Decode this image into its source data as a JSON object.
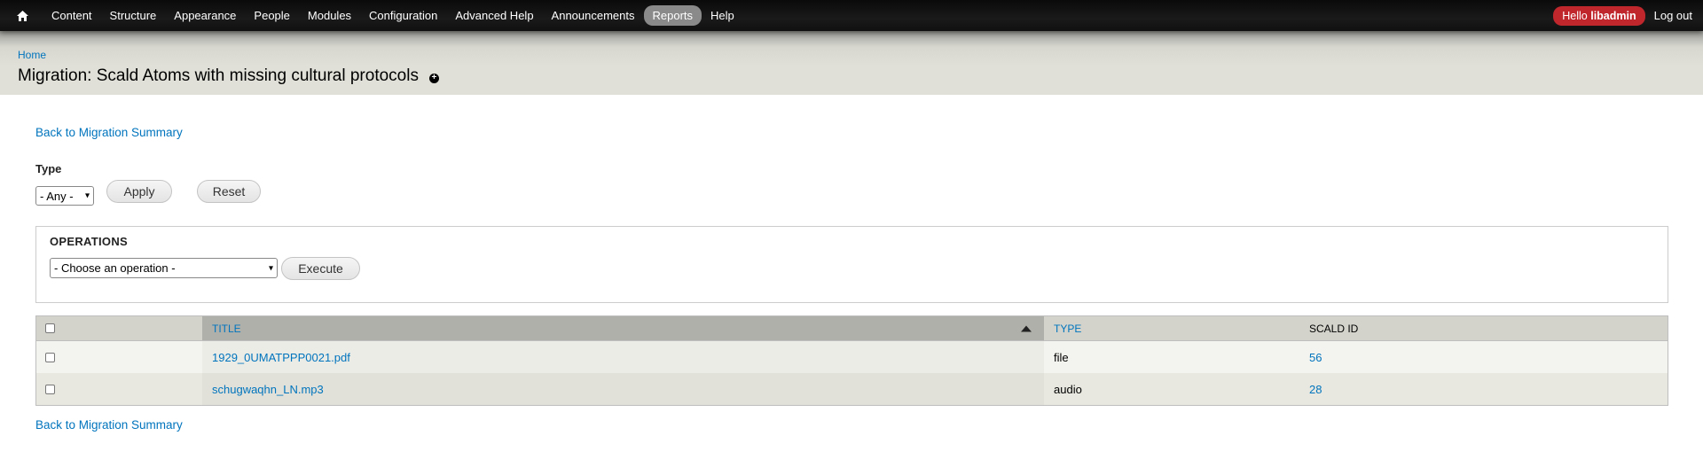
{
  "toolbar": {
    "home_icon": "home-icon",
    "items": [
      "Content",
      "Structure",
      "Appearance",
      "People",
      "Modules",
      "Configuration",
      "Advanced Help",
      "Announcements",
      "Reports",
      "Help"
    ],
    "active_item": "Reports",
    "hello_prefix": "Hello",
    "hello_user": "libadmin",
    "logout": "Log out",
    "colors": {
      "bar": "#111111",
      "active_pill": "#8a8a8a",
      "user_pill": "#c0272d"
    }
  },
  "header": {
    "breadcrumb": "Home",
    "title": "Migration: Scald Atoms with missing cultural protocols",
    "shortcut_icon": "add-shortcut-icon"
  },
  "back_link": "Back to Migration Summary",
  "filter": {
    "type_label": "Type",
    "type_value": "- Any -",
    "apply": "Apply",
    "reset": "Reset"
  },
  "operations": {
    "legend": "OPERATIONS",
    "select_value": "- Choose an operation -",
    "execute": "Execute"
  },
  "table": {
    "headers": {
      "title": "TITLE",
      "type": "TYPE",
      "scald_id": "SCALD ID"
    },
    "sort": {
      "column": "TITLE",
      "direction": "ascending"
    },
    "rows": [
      {
        "title": "1929_0UMATPPP0021.pdf",
        "type": "file",
        "scald_id": "56"
      },
      {
        "title": "schugwaqhn_LN.mp3",
        "type": "audio",
        "scald_id": "28"
      }
    ]
  },
  "colors": {
    "link": "#0074bd",
    "header_band": "#e0e0d8"
  }
}
